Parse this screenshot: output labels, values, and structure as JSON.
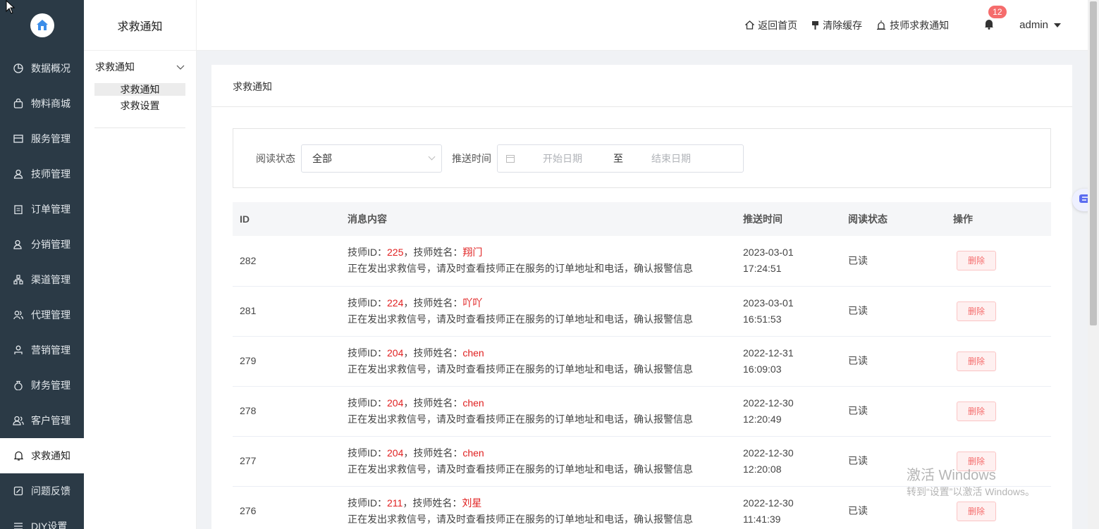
{
  "sidebar": {
    "items": [
      {
        "label": "数据概况",
        "icon": "pie-chart-icon"
      },
      {
        "label": "物料商城",
        "icon": "shopping-bag-icon"
      },
      {
        "label": "服务管理",
        "icon": "service-icon"
      },
      {
        "label": "技师管理",
        "icon": "user-icon"
      },
      {
        "label": "订单管理",
        "icon": "clipboard-icon"
      },
      {
        "label": "分销管理",
        "icon": "user-share-icon"
      },
      {
        "label": "渠道管理",
        "icon": "network-icon"
      },
      {
        "label": "代理管理",
        "icon": "users-icon"
      },
      {
        "label": "营销管理",
        "icon": "marketing-icon"
      },
      {
        "label": "财务管理",
        "icon": "money-bag-icon"
      },
      {
        "label": "客户管理",
        "icon": "customer-icon"
      },
      {
        "label": "求救通知",
        "icon": "bell-icon"
      },
      {
        "label": "问题反馈",
        "icon": "edit-icon"
      },
      {
        "label": "DIY设置",
        "icon": "settings-icon"
      }
    ],
    "active_index": 11
  },
  "submenu": {
    "title": "求救通知",
    "group_label": "求救通知",
    "items": [
      "求救通知",
      "求救设置"
    ]
  },
  "header": {
    "home_link": "返回首页",
    "clear_cache": "清除缓存",
    "sos_notice": "技师求救通知",
    "badge_count": "12",
    "user": "admin"
  },
  "card": {
    "title": "求救通知"
  },
  "filter": {
    "read_status_label": "阅读状态",
    "read_status_value": "全部",
    "push_time_label": "推送时间",
    "start_placeholder": "开始日期",
    "separator": "至",
    "end_placeholder": "结束日期"
  },
  "table": {
    "columns": [
      "ID",
      "消息内容",
      "推送时间",
      "阅读状态",
      "操作"
    ],
    "tech_id_label": "技师ID：",
    "tech_name_label": "，技师姓名：",
    "message_suffix": "正在发出求救信号，请及时查看技师正在服务的订单地址和电话，确认报警信息",
    "delete_label": "删除",
    "rows": [
      {
        "id": "282",
        "tech_id": "225",
        "tech_name": "翔门",
        "date": "2023-03-01",
        "time": "17:24:51",
        "status": "已读"
      },
      {
        "id": "281",
        "tech_id": "224",
        "tech_name": "吖吖",
        "date": "2023-03-01",
        "time": "16:51:53",
        "status": "已读"
      },
      {
        "id": "279",
        "tech_id": "204",
        "tech_name": "chen",
        "date": "2022-12-31",
        "time": "16:09:03",
        "status": "已读"
      },
      {
        "id": "278",
        "tech_id": "204",
        "tech_name": "chen",
        "date": "2022-12-30",
        "time": "12:20:49",
        "status": "已读"
      },
      {
        "id": "277",
        "tech_id": "204",
        "tech_name": "chen",
        "date": "2022-12-30",
        "time": "12:20:08",
        "status": "已读"
      },
      {
        "id": "276",
        "tech_id": "211",
        "tech_name": "刘星",
        "date": "2022-12-30",
        "time": "11:41:39",
        "status": "已读"
      }
    ]
  },
  "watermark": {
    "line1": "激活 Windows",
    "line2": "转到“设置”以激活 Windows。"
  }
}
